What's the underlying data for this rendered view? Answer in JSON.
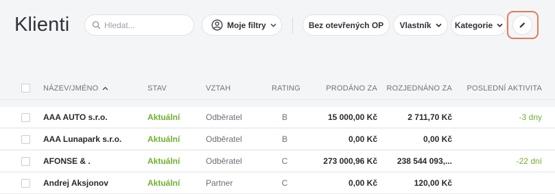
{
  "page": {
    "title": "Klienti"
  },
  "toolbar": {
    "search_placeholder": "Hledat...",
    "my_filters": "Moje filtry",
    "no_open_op": "Bez otevřených OP",
    "owner": "Vlastník",
    "category": "Kategorie"
  },
  "table": {
    "columns": {
      "name": "NÁZEV/JMÉNO",
      "stav": "STAV",
      "vztah": "VZTAH",
      "rating": "RATING",
      "prodano": "PRODÁNO ZA",
      "rozjednano": "ROZJEDNÁNO ZA",
      "aktivita": "POSLEDNÍ AKTIVITA"
    },
    "rows": [
      {
        "name": "AAA AUTO s.r.o.",
        "stav": "Aktuální",
        "vztah": "Odběratel",
        "rating": "B",
        "prodano": "15 000,00 Kč",
        "rozjednano": "2 711,70 Kč",
        "aktivita": "-3 dny"
      },
      {
        "name": "AAA Lunapark s.r.o.",
        "stav": "Aktuální",
        "vztah": "Odběratel",
        "rating": "B",
        "prodano": "0,00 Kč",
        "rozjednano": "0,00 Kč",
        "aktivita": ""
      },
      {
        "name": "AFONSE & .",
        "stav": "Aktuální",
        "vztah": "Odběratel",
        "rating": "C",
        "prodano": "273 000,96 Kč",
        "rozjednano": "238 544 093,...",
        "aktivita": "-22 dní"
      },
      {
        "name": "Andrej Aksjonov",
        "stav": "Aktuální",
        "vztah": "Partner",
        "rating": "C",
        "prodano": "0,00 Kč",
        "rozjednano": "120,00 Kč",
        "aktivita": ""
      }
    ]
  },
  "colors": {
    "accent_green": "#6fb02d",
    "highlight_orange": "#e4795a"
  },
  "icons": {
    "search": "search-icon",
    "user": "user-circle-icon",
    "edit": "pencil-icon",
    "sort": "sort-ascending-icon"
  }
}
